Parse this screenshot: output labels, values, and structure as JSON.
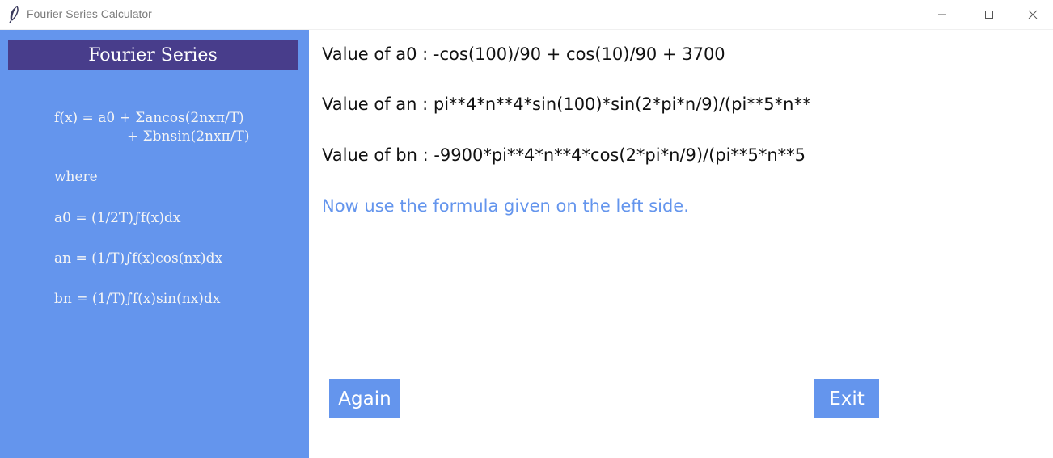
{
  "window": {
    "title": "Fourier Series Calculator",
    "icon": "feather-icon"
  },
  "sidebar": {
    "header": "Fourier Series",
    "formula_line1": "f(x) = a0 + Σancos(2nxπ/T)",
    "formula_line2": "+ Σbnsin(2nxπ/T)",
    "where": "where",
    "a0_formula": "a0 = (1/2T)∫f(x)dx",
    "an_formula": "an = (1/T)∫f(x)cos(nx)dx",
    "bn_formula": "bn = (1/T)∫f(x)sin(nx)dx"
  },
  "results": {
    "a0": "Value of a0 : -cos(100)/90 + cos(10)/90 + 3700",
    "an": "Value of an : pi**4*n**4*sin(100)*sin(2*pi*n/9)/(pi**5*n**",
    "bn": "Value of bn : -9900*pi**4*n**4*cos(2*pi*n/9)/(pi**5*n**5",
    "hint": "Now use the formula given on the left side."
  },
  "buttons": {
    "again": "Again",
    "exit": "Exit"
  },
  "colors": {
    "panel": "#6495ed",
    "header": "#483d8b",
    "hint": "#6495ed"
  }
}
